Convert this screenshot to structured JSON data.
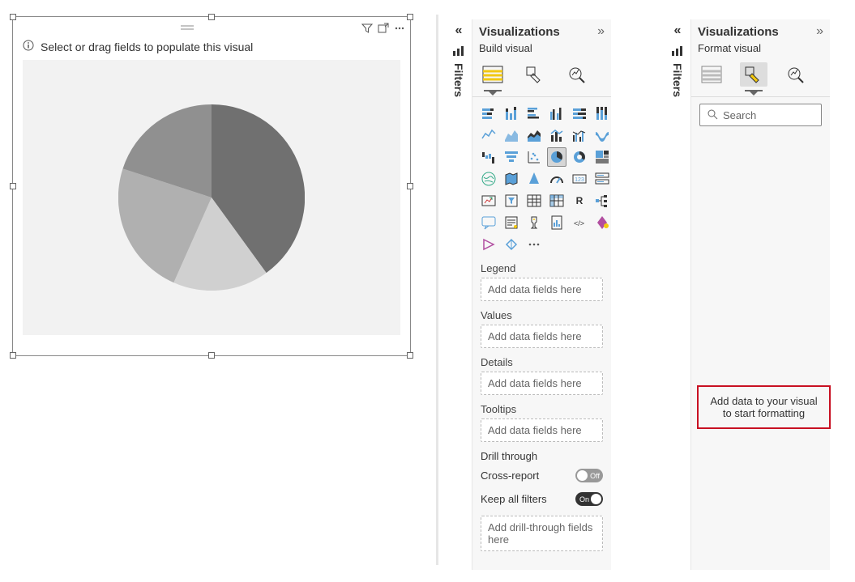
{
  "canvas": {
    "hint": "Select or drag fields to populate this visual"
  },
  "filters_label": "Filters",
  "panel1": {
    "title": "Visualizations",
    "subtitle": "Build visual",
    "wells": {
      "legend_label": "Legend",
      "legend_placeholder": "Add data fields here",
      "values_label": "Values",
      "values_placeholder": "Add data fields here",
      "details_label": "Details",
      "details_placeholder": "Add data fields here",
      "tooltips_label": "Tooltips",
      "tooltips_placeholder": "Add data fields here"
    },
    "drill": {
      "heading": "Drill through",
      "cross_report_label": "Cross-report",
      "cross_report_value": "Off",
      "keep_filters_label": "Keep all filters",
      "keep_filters_value": "On",
      "placeholder": "Add drill-through fields here"
    }
  },
  "panel2": {
    "title": "Visualizations",
    "subtitle": "Format visual",
    "search_placeholder": "Search",
    "empty_line1": "Add data to your visual",
    "empty_line2": "to start formatting"
  },
  "chart_data": {
    "type": "pie",
    "title": "",
    "values": [
      40,
      23,
      13,
      24
    ],
    "colors": [
      "707070",
      "909090",
      "d0d0d0",
      "b0b0b0"
    ],
    "note": "placeholder pie with no labels/legend; values are approximate slice proportions"
  }
}
